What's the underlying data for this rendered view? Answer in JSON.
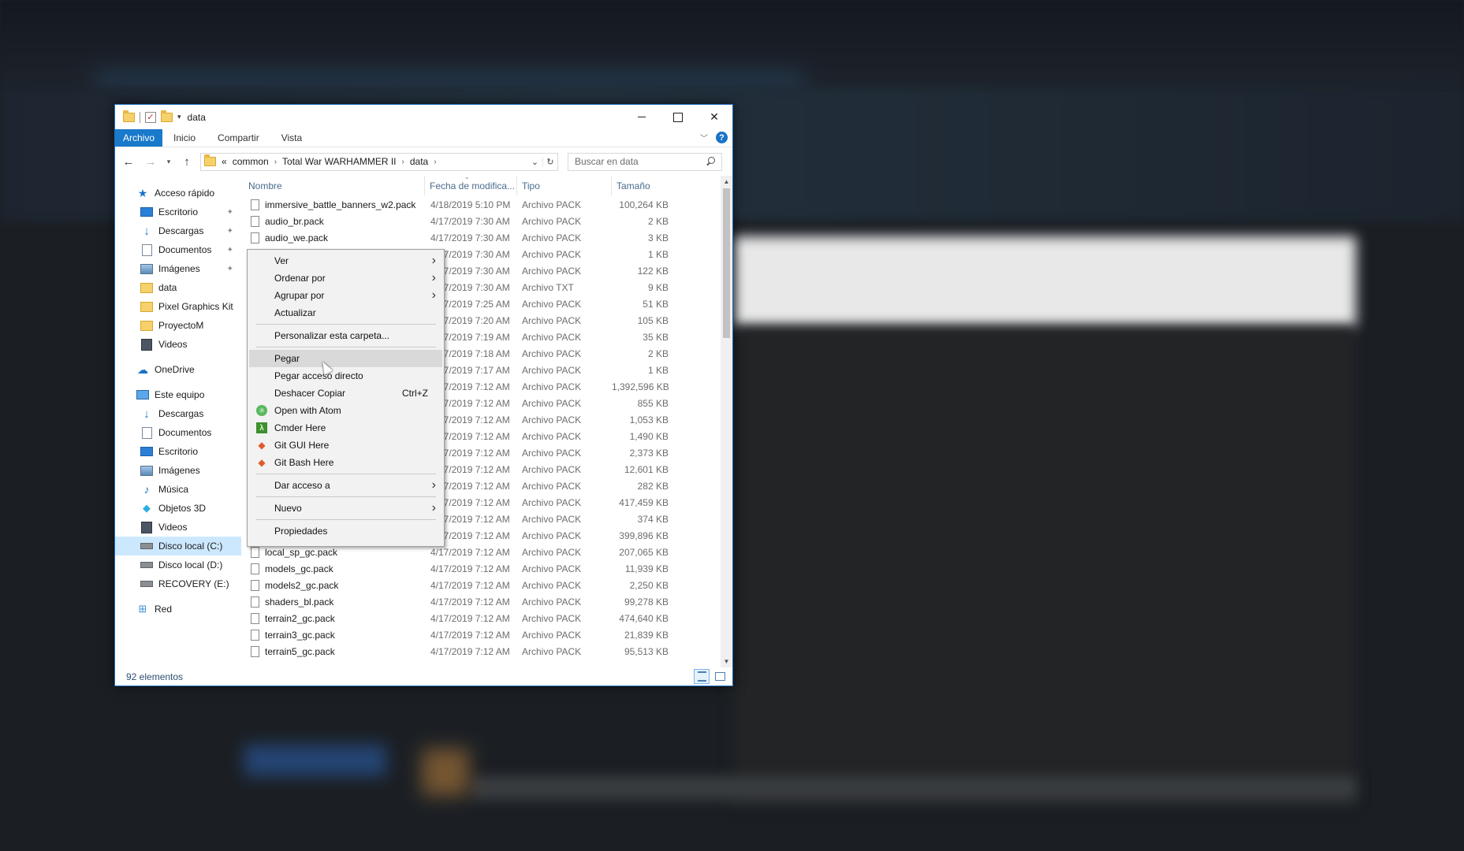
{
  "window": {
    "title": "data",
    "controls": {
      "minimize": "",
      "maximize": "",
      "close": "✕"
    }
  },
  "ribbon": {
    "tabs": [
      "Archivo",
      "Inicio",
      "Compartir",
      "Vista"
    ],
    "help": "?"
  },
  "address": {
    "overflow": "«",
    "crumbs": [
      "common",
      "Total War WARHAMMER II",
      "data"
    ]
  },
  "search": {
    "placeholder": "Buscar en data"
  },
  "sidebar": {
    "items": [
      {
        "label": "Acceso rápido",
        "icon": "star-icon",
        "level": 0,
        "pinned": false
      },
      {
        "label": "Escritorio",
        "icon": "desktop-icon",
        "level": 1,
        "pinned": true
      },
      {
        "label": "Descargas",
        "icon": "downloads-icon",
        "level": 1,
        "pinned": true
      },
      {
        "label": "Documentos",
        "icon": "documents-icon",
        "level": 1,
        "pinned": true
      },
      {
        "label": "Imágenes",
        "icon": "pictures-icon",
        "level": 1,
        "pinned": true
      },
      {
        "label": "data",
        "icon": "folder-icon",
        "level": 1,
        "pinned": false
      },
      {
        "label": "Pixel Graphics Kit",
        "icon": "folder-icon",
        "level": 1,
        "pinned": false
      },
      {
        "label": "ProyectoM",
        "icon": "folder-icon",
        "level": 1,
        "pinned": false
      },
      {
        "label": "Videos",
        "icon": "videos-icon",
        "level": 1,
        "pinned": false
      },
      {
        "label": "OneDrive",
        "icon": "cloud-icon",
        "level": 0,
        "pinned": false
      },
      {
        "label": "Este equipo",
        "icon": "computer-icon",
        "level": 0,
        "pinned": false
      },
      {
        "label": "Descargas",
        "icon": "downloads-icon",
        "level": 1,
        "pinned": false
      },
      {
        "label": "Documentos",
        "icon": "documents-icon",
        "level": 1,
        "pinned": false
      },
      {
        "label": "Escritorio",
        "icon": "desktop-icon",
        "level": 1,
        "pinned": false
      },
      {
        "label": "Imágenes",
        "icon": "pictures-icon",
        "level": 1,
        "pinned": false
      },
      {
        "label": "Música",
        "icon": "music-icon",
        "level": 1,
        "pinned": false
      },
      {
        "label": "Objetos 3D",
        "icon": "objects-3d-icon",
        "level": 1,
        "pinned": false
      },
      {
        "label": "Videos",
        "icon": "videos-icon",
        "level": 1,
        "pinned": false
      },
      {
        "label": "Disco local (C:)",
        "icon": "drive-icon",
        "level": 1,
        "pinned": false,
        "selected": true
      },
      {
        "label": "Disco local (D:)",
        "icon": "drive-icon",
        "level": 1,
        "pinned": false
      },
      {
        "label": "RECOVERY (E:)",
        "icon": "drive-icon",
        "level": 1,
        "pinned": false
      },
      {
        "label": "Red",
        "icon": "network-icon",
        "level": 0,
        "pinned": false
      }
    ]
  },
  "columns": {
    "name": "Nombre",
    "date": "Fecha de modifica...",
    "type": "Tipo",
    "size": "Tamaño"
  },
  "files": [
    {
      "name": "immersive_battle_banners_w2.pack",
      "date": "4/18/2019 5:10 PM",
      "type": "Archivo PACK",
      "size": "100,264 KB"
    },
    {
      "name": "audio_br.pack",
      "date": "4/17/2019 7:30 AM",
      "type": "Archivo PACK",
      "size": "2 KB"
    },
    {
      "name": "audio_we.pack",
      "date": "4/17/2019 7:30 AM",
      "type": "Archivo PACK",
      "size": "3 KB"
    },
    {
      "name": "",
      "date": "4/17/2019 7:30 AM",
      "type": "Archivo PACK",
      "size": "1 KB"
    },
    {
      "name": "",
      "date": "4/17/2019 7:30 AM",
      "type": "Archivo PACK",
      "size": "122 KB"
    },
    {
      "name": "",
      "date": "4/17/2019 7:30 AM",
      "type": "Archivo TXT",
      "size": "9 KB"
    },
    {
      "name": "",
      "date": "4/17/2019 7:25 AM",
      "type": "Archivo PACK",
      "size": "51 KB"
    },
    {
      "name": "",
      "date": "4/17/2019 7:20 AM",
      "type": "Archivo PACK",
      "size": "105 KB"
    },
    {
      "name": "",
      "date": "4/17/2019 7:19 AM",
      "type": "Archivo PACK",
      "size": "35 KB"
    },
    {
      "name": "",
      "date": "4/17/2019 7:18 AM",
      "type": "Archivo PACK",
      "size": "2 KB"
    },
    {
      "name": "",
      "date": "4/17/2019 7:17 AM",
      "type": "Archivo PACK",
      "size": "1 KB"
    },
    {
      "name": "",
      "date": "4/17/2019 7:12 AM",
      "type": "Archivo PACK",
      "size": "1,392,596 KB"
    },
    {
      "name": "",
      "date": "4/17/2019 7:12 AM",
      "type": "Archivo PACK",
      "size": "855 KB"
    },
    {
      "name": "",
      "date": "4/17/2019 7:12 AM",
      "type": "Archivo PACK",
      "size": "1,053 KB"
    },
    {
      "name": "",
      "date": "4/17/2019 7:12 AM",
      "type": "Archivo PACK",
      "size": "1,490 KB"
    },
    {
      "name": "",
      "date": "4/17/2019 7:12 AM",
      "type": "Archivo PACK",
      "size": "2,373 KB"
    },
    {
      "name": "",
      "date": "4/17/2019 7:12 AM",
      "type": "Archivo PACK",
      "size": "12,601 KB"
    },
    {
      "name": "",
      "date": "4/17/2019 7:12 AM",
      "type": "Archivo PACK",
      "size": "282 KB"
    },
    {
      "name": "",
      "date": "4/17/2019 7:12 AM",
      "type": "Archivo PACK",
      "size": "417,459 KB"
    },
    {
      "name": "",
      "date": "4/17/2019 7:12 AM",
      "type": "Archivo PACK",
      "size": "374 KB"
    },
    {
      "name": "",
      "date": "4/17/2019 7:12 AM",
      "type": "Archivo PACK",
      "size": "399,896 KB"
    },
    {
      "name": "local_sp_gc.pack",
      "date": "4/17/2019 7:12 AM",
      "type": "Archivo PACK",
      "size": "207,065 KB"
    },
    {
      "name": "models_gc.pack",
      "date": "4/17/2019 7:12 AM",
      "type": "Archivo PACK",
      "size": "11,939 KB"
    },
    {
      "name": "models2_gc.pack",
      "date": "4/17/2019 7:12 AM",
      "type": "Archivo PACK",
      "size": "2,250 KB"
    },
    {
      "name": "shaders_bl.pack",
      "date": "4/17/2019 7:12 AM",
      "type": "Archivo PACK",
      "size": "99,278 KB"
    },
    {
      "name": "terrain2_gc.pack",
      "date": "4/17/2019 7:12 AM",
      "type": "Archivo PACK",
      "size": "474,640 KB"
    },
    {
      "name": "terrain3_gc.pack",
      "date": "4/17/2019 7:12 AM",
      "type": "Archivo PACK",
      "size": "21,839 KB"
    },
    {
      "name": "terrain5_gc.pack",
      "date": "4/17/2019 7:12 AM",
      "type": "Archivo PACK",
      "size": "95,513 KB"
    }
  ],
  "status": {
    "count": "92 elementos"
  },
  "context_menu": {
    "groups": [
      [
        {
          "label": "Ver",
          "submenu": true
        },
        {
          "label": "Ordenar por",
          "submenu": true
        },
        {
          "label": "Agrupar por",
          "submenu": true
        },
        {
          "label": "Actualizar"
        }
      ],
      [
        {
          "label": "Personalizar esta carpeta..."
        }
      ],
      [
        {
          "label": "Pegar",
          "hover": true
        },
        {
          "label": "Pegar acceso directo"
        },
        {
          "label": "Deshacer Copiar",
          "shortcut": "Ctrl+Z"
        },
        {
          "label": "Open with Atom",
          "icon": "atom-icon"
        },
        {
          "label": "Cmder Here",
          "icon": "cmder-icon"
        },
        {
          "label": "Git GUI Here",
          "icon": "git-icon"
        },
        {
          "label": "Git Bash Here",
          "icon": "git-icon"
        }
      ],
      [
        {
          "label": "Dar acceso a",
          "submenu": true
        }
      ],
      [
        {
          "label": "Nuevo",
          "submenu": true
        }
      ],
      [
        {
          "label": "Propiedades"
        }
      ]
    ]
  },
  "colors": {
    "accent": "#1979ca",
    "selection": "#cce8ff",
    "menu_bg": "#f2f2f2"
  }
}
